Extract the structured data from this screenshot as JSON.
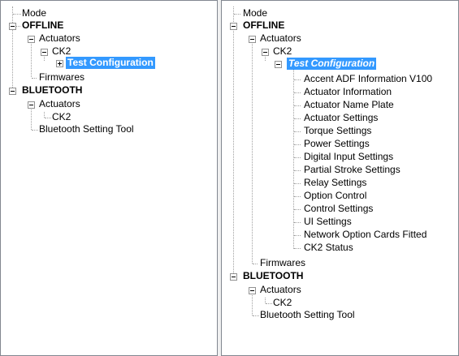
{
  "left_tree": {
    "mode": "Mode",
    "offline": "OFFLINE",
    "actuators": "Actuators",
    "ck2": "CK2",
    "test_configuration": "Test Configuration",
    "firmwares": "Firmwares",
    "bluetooth": "BLUETOOTH",
    "bt_actuators": "Actuators",
    "bt_ck2": "CK2",
    "bt_setting_tool": "Bluetooth Setting Tool"
  },
  "right_tree": {
    "mode": "Mode",
    "offline": "OFFLINE",
    "actuators": "Actuators",
    "ck2": "CK2",
    "test_configuration": "Test Configuration",
    "items": [
      "Accent ADF Information V100",
      "Actuator Information",
      "Actuator Name Plate",
      "Actuator Settings",
      "Torque Settings",
      "Power Settings",
      "Digital Input Settings",
      "Partial Stroke Settings",
      "Relay Settings",
      "Option Control",
      "Control Settings",
      "UI Settings",
      "Network Option Cards Fitted",
      "CK2 Status"
    ],
    "firmwares": "Firmwares",
    "bluetooth": "BLUETOOTH",
    "bt_actuators": "Actuators",
    "bt_ck2": "CK2",
    "bt_setting_tool": "Bluetooth Setting Tool"
  },
  "colors": {
    "selection": "#3399ff",
    "pane_border": "#828790",
    "tree_lines": "#a0a0a0"
  }
}
